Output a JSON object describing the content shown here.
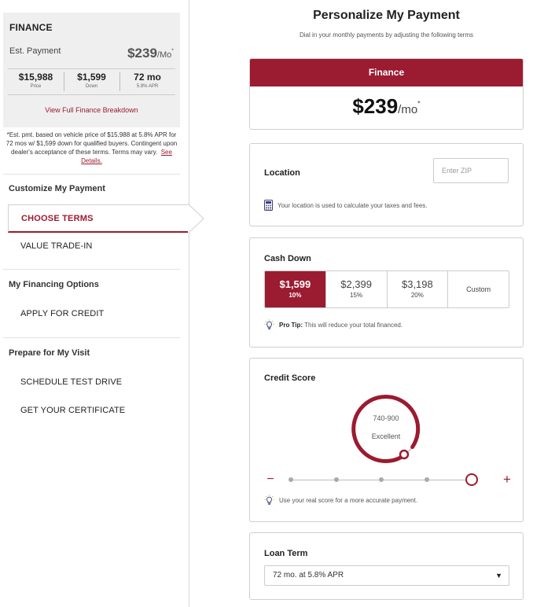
{
  "sidebar": {
    "finance_box": {
      "title": "FINANCE",
      "est_label": "Est. Payment",
      "est_amount": "$239",
      "est_unit": "/Mo",
      "est_mark": "*",
      "stats": [
        {
          "value": "$15,988",
          "label": "Price"
        },
        {
          "value": "$1,599",
          "label": "Down"
        },
        {
          "value": "72 mo",
          "label": "5.8% APR"
        }
      ],
      "breakdown_link": "View Full Finance Breakdown"
    },
    "disclaimer": "*Est. pmt. based on vehicle price of $15,988 at 5.8% APR for 72 mos w/ $1,599 down for qualified buyers. Contingent upon dealer's acceptance of these terms. Terms may vary.",
    "disclaimer_link": "See Details.",
    "sections": {
      "customize": {
        "heading": "Customize My Payment",
        "active_item": "CHOOSE TERMS",
        "item_trade": "VALUE TRADE-IN"
      },
      "financing": {
        "heading": "My Financing Options",
        "item_credit": "APPLY FOR CREDIT"
      },
      "visit": {
        "heading": "Prepare for My Visit",
        "item_test_drive": "SCHEDULE TEST DRIVE",
        "item_certificate": "GET YOUR CERTIFICATE"
      }
    }
  },
  "main": {
    "title": "Personalize My Payment",
    "subtitle": "Dial in your monthly payments by adjusting the following terms",
    "finance_card": {
      "band": "Finance",
      "amount": "$239",
      "unit": "/mo",
      "mark": "*"
    },
    "location": {
      "label": "Location",
      "zip_placeholder": "Enter ZIP",
      "note": "Your location is used to calculate your taxes and fees."
    },
    "cash_down": {
      "label": "Cash Down",
      "options": [
        {
          "value": "$1,599",
          "pct": "10%"
        },
        {
          "value": "$2,399",
          "pct": "15%"
        },
        {
          "value": "$3,198",
          "pct": "20%"
        }
      ],
      "custom_label": "Custom",
      "tip_bold": "Pro Tip:",
      "tip_text": " This will reduce your total financed."
    },
    "credit": {
      "label": "Credit Score",
      "range": "740-900",
      "level": "Excellent",
      "selected_step": 5,
      "steps": 5,
      "minus": "−",
      "plus": "+",
      "tip": "Use your real score for a more accurate payment."
    },
    "loan_term": {
      "label": "Loan Term",
      "selected": "72 mo. at 5.8% APR",
      "caret": "▼"
    }
  },
  "colors": {
    "accent": "#9b1b30",
    "panel_bg": "#efefef"
  }
}
